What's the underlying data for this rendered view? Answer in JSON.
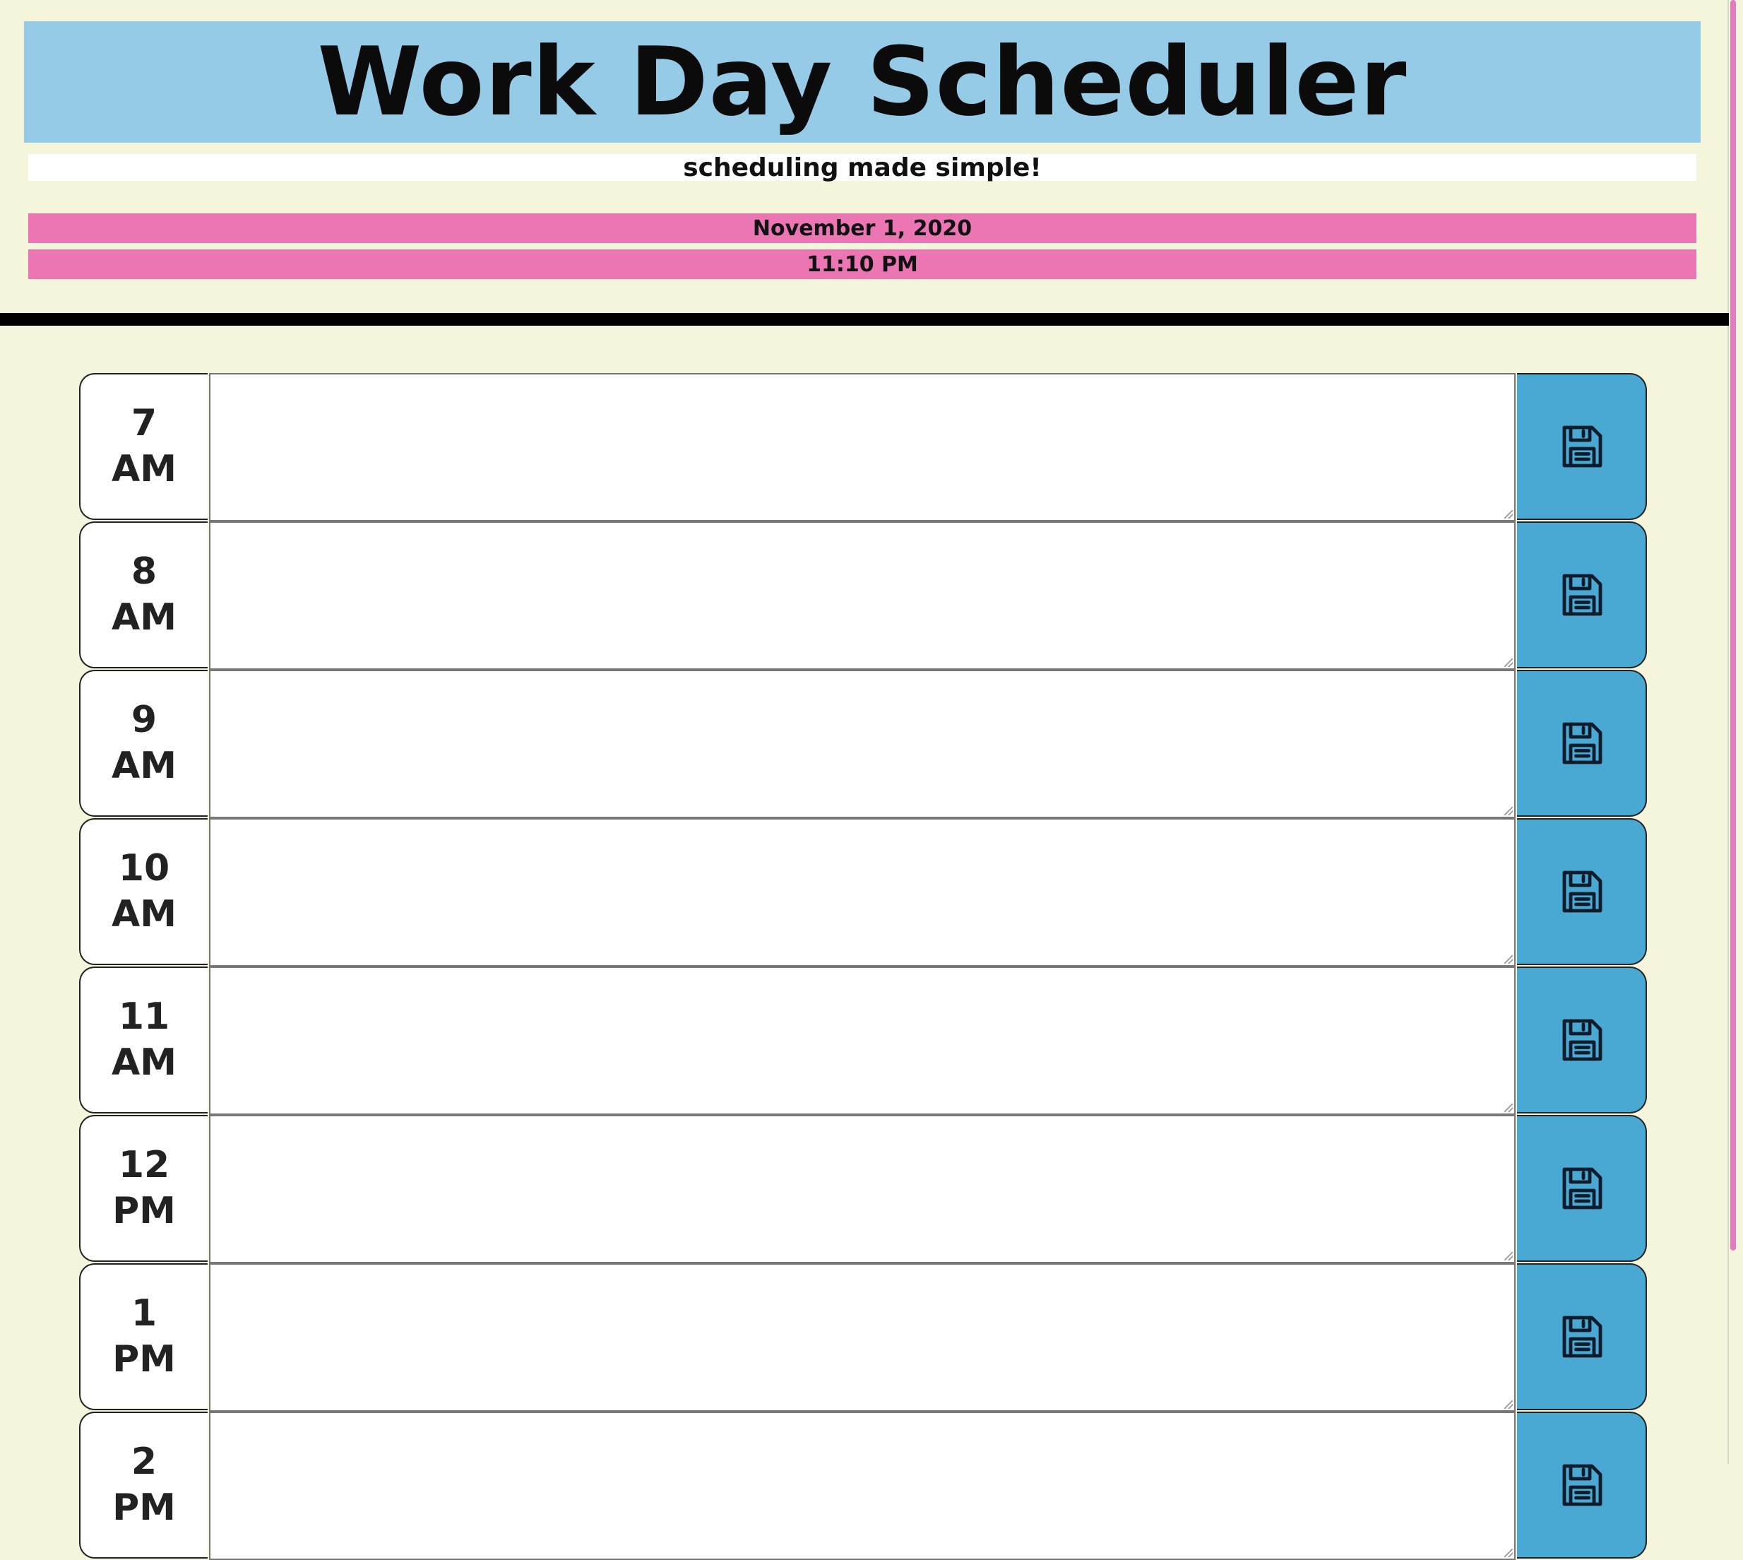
{
  "header": {
    "title": "Work Day Scheduler",
    "subtitle": "scheduling made simple!",
    "date": "November 1, 2020",
    "time": "11:10 PM"
  },
  "icons": {
    "save": "floppy-disk-icon"
  },
  "colors": {
    "background": "#f5f5dc",
    "header_banner": "#96cbe8",
    "date_bar": "#ec75b3",
    "save_button": "#4aa9d3",
    "scrollbar": "#e27cc1"
  },
  "hours": [
    {
      "num": "7",
      "period": "AM",
      "entry": ""
    },
    {
      "num": "8",
      "period": "AM",
      "entry": ""
    },
    {
      "num": "9",
      "period": "AM",
      "entry": ""
    },
    {
      "num": "10",
      "period": "AM",
      "entry": ""
    },
    {
      "num": "11",
      "period": "AM",
      "entry": ""
    },
    {
      "num": "12",
      "period": "PM",
      "entry": ""
    },
    {
      "num": "1",
      "period": "PM",
      "entry": ""
    },
    {
      "num": "2",
      "period": "PM",
      "entry": ""
    }
  ]
}
